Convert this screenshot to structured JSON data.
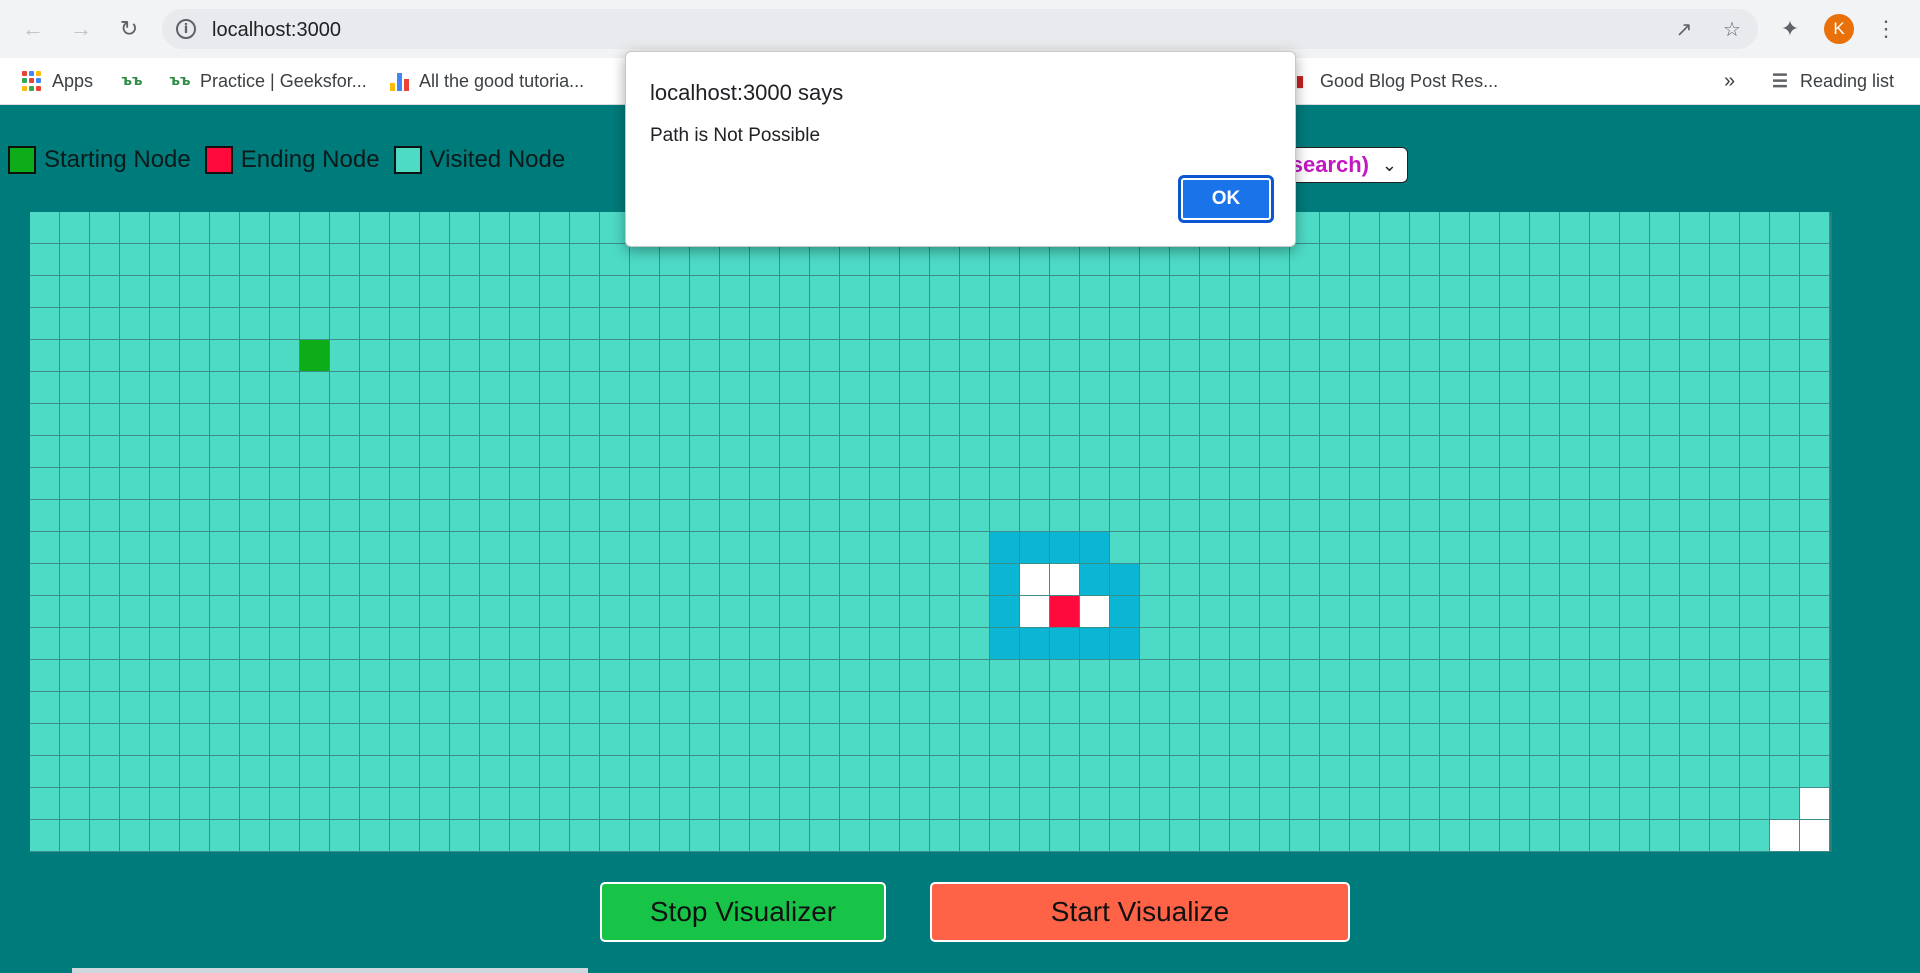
{
  "browser": {
    "url": "localhost:3000",
    "avatar_letter": "K",
    "bookmarks": [
      {
        "label": "Apps",
        "icon": "apps-grid-icon"
      },
      {
        "label": "",
        "icon": "geeksforgeeks-icon"
      },
      {
        "label": "Practice | Geeksfor...",
        "icon": "geeksforgeeks-icon"
      },
      {
        "label": "All the good tutoria...",
        "icon": "bar-chart-icon"
      },
      {
        "label": "Good Blog Post Res...",
        "icon": "bookmark-icon"
      }
    ],
    "more_bookmarks": "»",
    "reading_list": "Reading list"
  },
  "legend": [
    {
      "label": "Starting Node",
      "color": "#0cad18"
    },
    {
      "label": "Ending Node",
      "color": "#ff0a3c"
    },
    {
      "label": "Visited Node",
      "color": "#4ddbc6"
    }
  ],
  "algorithm_select": {
    "visible_text": "search)"
  },
  "grid": {
    "rows": 20,
    "cols": 60,
    "start": [
      4,
      9
    ],
    "end": [
      12,
      34
    ],
    "walls": [
      [
        11,
        33
      ],
      [
        11,
        34
      ],
      [
        12,
        33
      ],
      [
        12,
        35
      ],
      [
        18,
        59
      ],
      [
        19,
        58
      ],
      [
        19,
        59
      ]
    ],
    "frontier": [
      [
        10,
        32
      ],
      [
        10,
        33
      ],
      [
        10,
        34
      ],
      [
        10,
        35
      ],
      [
        11,
        32
      ],
      [
        11,
        35
      ],
      [
        11,
        36
      ],
      [
        12,
        32
      ],
      [
        12,
        36
      ],
      [
        13,
        32
      ],
      [
        13,
        33
      ],
      [
        13,
        34
      ],
      [
        13,
        35
      ],
      [
        13,
        36
      ]
    ],
    "colors": {
      "visited": "#4ddbc6",
      "frontier": "#0bb5d4",
      "wall": "#ffffff",
      "start": "#0cad18",
      "end": "#ff0a3c"
    }
  },
  "buttons": {
    "stop": "Stop Visualizer",
    "start": "Start Visualize"
  },
  "dialog": {
    "title": "localhost:3000 says",
    "message": "Path is Not Possible",
    "ok": "OK"
  }
}
